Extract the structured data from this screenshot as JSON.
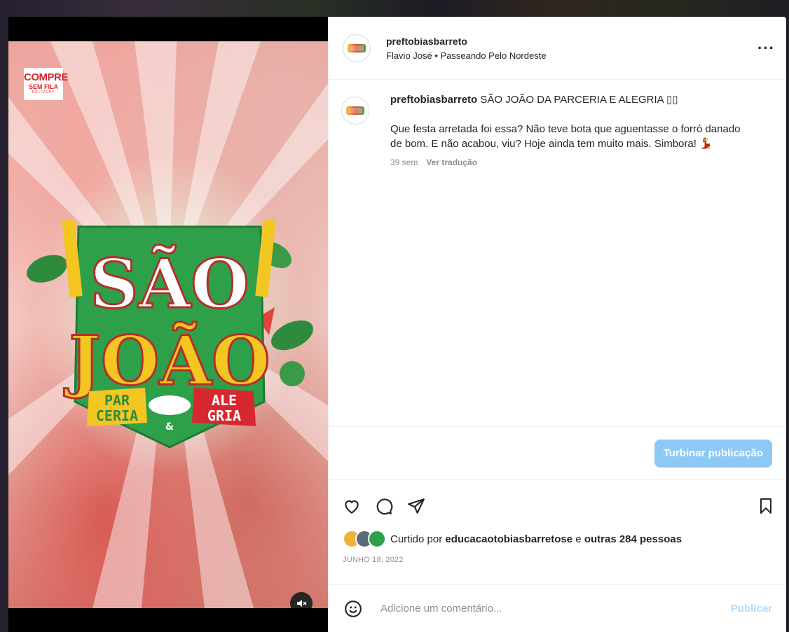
{
  "post": {
    "username": "preftobiasbarreto",
    "subtitle": "Flavio José • Passeando Pelo Nordeste",
    "more_icon": "more-horizontal-icon"
  },
  "media": {
    "brand_line1": "COMPRE",
    "brand_line2": "SEM FILA",
    "brand_line3": "DELIVERY",
    "logo_word1": "SÃO",
    "logo_word2": "JOÃO",
    "logo_left1": "PAR",
    "logo_left2": "CERIA",
    "logo_right1": "ALE",
    "logo_right2": "GRIA",
    "logo_amp": "&",
    "mute_icon": "speaker-muted-icon"
  },
  "caption": {
    "username": "preftobiasbarreto",
    "headline": "SÃO JOÃO DA PARCERIA E ALEGRIA ▯▯",
    "body": "Que festa arretada foi essa? Não teve bota que aguentasse o forró danado de bom. E não acabou, viu? Hoje ainda tem muito mais. Simbora! 💃",
    "time": "39 sem",
    "translate": "Ver tradução"
  },
  "boost": {
    "label": "Turbinar publicação"
  },
  "actions": {
    "liked_prefix": "Curtido por",
    "liked_user": "educacaotobiasbarretose",
    "liked_and": "e",
    "liked_others": "outras 284 pessoas",
    "date": "JUNHO 18, 2022"
  },
  "comment": {
    "placeholder": "Adicione um comentário...",
    "publish": "Publicar"
  },
  "colors": {
    "accent": "#0095f6",
    "boost_btn": "#8ec8f5",
    "logo_green": "#2ea04a",
    "logo_yellow": "#f3c622",
    "logo_red": "#d7282f"
  }
}
